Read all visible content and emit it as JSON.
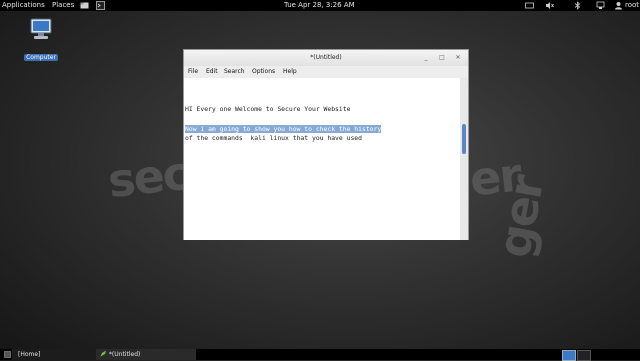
{
  "top_panel": {
    "applications": "Applications",
    "places": "Places",
    "clock": "Tue Apr 28,  3:26 AM",
    "user": "root",
    "icons": [
      "terminal-icon",
      "network-icon",
      "volume-icon",
      "bluetooth-icon",
      "user-icon"
    ]
  },
  "desktop": {
    "icon_label": "Computer"
  },
  "window": {
    "title": "*(Untitled)",
    "menu": [
      "File",
      "Edit",
      "Search",
      "Options",
      "Help"
    ],
    "lines": [
      "HI Every one Welcome to Secure Your Website",
      "Now i am going to show you how to check the history",
      "of the commands  kali linux that you have used"
    ]
  },
  "taskbar": {
    "home": "[Home]",
    "editor": "*(Untitled)"
  }
}
